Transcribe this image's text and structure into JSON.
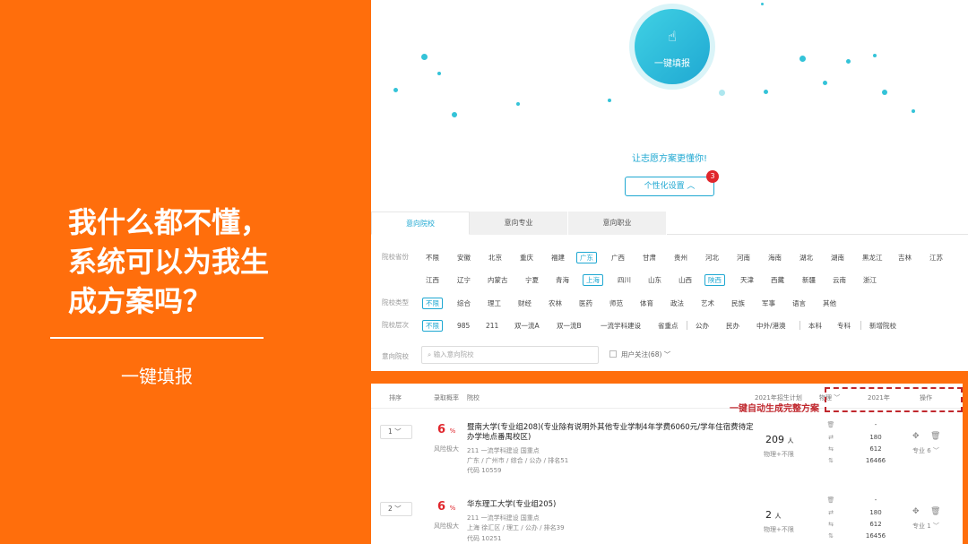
{
  "slide": {
    "headline": [
      "我什么都不懂，",
      "系统可以为我生",
      "成方案吗？"
    ],
    "subtitle": "一键填报",
    "brand_color": "#FF6E0C"
  },
  "top": {
    "fill_button": "一键填报",
    "fill_icon": "hand-pointer-icon",
    "tagline": "让志愿方案更懂你!",
    "personalize_button": "个性化设置 ︿",
    "personalize_badge": "3",
    "tabs": [
      "意向院校",
      "意向专业",
      "意向职业"
    ],
    "filters": {
      "province_label": "院校省份",
      "provinces_row1": [
        "不限",
        "安徽",
        "北京",
        "重庆",
        "福建",
        "广东",
        "广西",
        "甘肃",
        "贵州",
        "河北",
        "河南",
        "海南",
        "湖北",
        "湖南",
        "黑龙江",
        "吉林",
        "江苏"
      ],
      "provinces_row2": [
        "江西",
        "辽宁",
        "内蒙古",
        "宁夏",
        "青海",
        "上海",
        "四川",
        "山东",
        "山西",
        "陕西",
        "天津",
        "西藏",
        "新疆",
        "云南",
        "浙江"
      ],
      "type_label": "院校类型",
      "types": [
        "不限",
        "综合",
        "理工",
        "财经",
        "农林",
        "医药",
        "师范",
        "体育",
        "政法",
        "艺术",
        "民族",
        "军事",
        "语言",
        "其他"
      ],
      "level_label": "院校层次",
      "levels_a": [
        "不限",
        "985",
        "211",
        "双一流A",
        "双一流B",
        "一流学科建设",
        "省重点"
      ],
      "levels_b": [
        "公办",
        "民办",
        "中外/港澳"
      ],
      "levels_c": [
        "本科",
        "专科"
      ],
      "levels_d": [
        "新增院校"
      ],
      "school_label": "意向院校",
      "search_placeholder": "输入意向院校",
      "follow_label": "用户关注(68) ﹀"
    }
  },
  "table": {
    "headers": {
      "order": "排序",
      "prob": "录取概率",
      "school": "院校",
      "plan": "2021年招生计划",
      "subject": "物理 ﹀",
      "year": "2021年",
      "ops": "操作"
    },
    "annotation": "一键自动生成完整方案",
    "rows": [
      {
        "order": "1 ﹀",
        "pct": "6",
        "pct_unit": "%",
        "risk": "风险极大",
        "name": "暨南大学(专业组208)(专业除有说明外其他专业学制4年学费6060元/学年住宿费待定办学地点番禺校区)",
        "tags": "211 一流学科建设  国重点",
        "location": "广东 / 广州市 / 综合 / 公办 / 排名51",
        "code": "代码 10559",
        "plan": "209",
        "plan_unit": "人",
        "plan_sub": "物理+不限",
        "year_values": [
          "-",
          "180",
          "612",
          "16466"
        ],
        "major": "专业 6 ﹀"
      },
      {
        "order": "2 ﹀",
        "pct": "6",
        "pct_unit": "%",
        "risk": "风险极大",
        "name": "华东理工大学(专业组205)",
        "tags": "211 一流学科建设  国重点",
        "location": "上海 徐汇区 / 理工 / 公办 / 排名39",
        "code": "代码 10251",
        "plan": "2",
        "plan_unit": "人",
        "plan_sub": "物理+不限",
        "year_values": [
          "-",
          "180",
          "612",
          "16456"
        ],
        "major": "专业 1 ﹀"
      }
    ]
  }
}
